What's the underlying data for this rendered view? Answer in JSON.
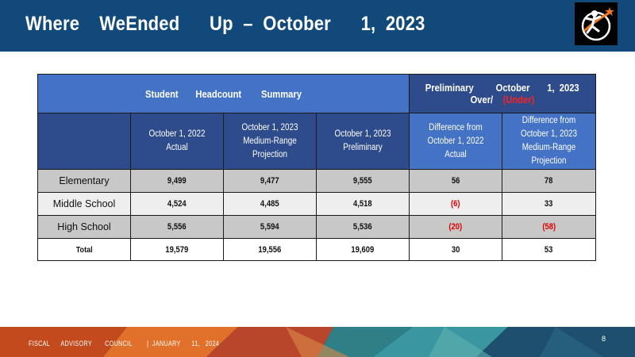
{
  "header": {
    "title": "Where    WeEnded      Up  –  October      1,  2023",
    "logo_icon": "runner-star-logo-icon",
    "background_color": "#114a7a"
  },
  "table": {
    "group_headers": {
      "summary": "Student       Headcount        Summary",
      "preliminary_line1": "Preliminary         October       1,  2023",
      "preliminary_over": "Over/",
      "preliminary_under": "(Under)"
    },
    "column_headers": [
      "",
      "October     1,  2022 Actual",
      "October     1,  2023 Medium-Range Projection",
      "October     1,  2023 Preliminary",
      "Difference       from October     1,  2022 Actual",
      "Difference       from October     1,  2023 Medium-Range Projection"
    ],
    "rows": [
      {
        "label": "Elementary",
        "values": [
          "9,499",
          "9,477",
          "9,555",
          "56",
          "78"
        ]
      },
      {
        "label": "Middle School",
        "values": [
          "4,524",
          "4,485",
          "4,518",
          "(6)",
          "33"
        ]
      },
      {
        "label": "High School",
        "values": [
          "5,556",
          "5,594",
          "5,536",
          "(20)",
          "(58)"
        ]
      },
      {
        "label": "Total",
        "values": [
          "19,579",
          "19,556",
          "19,609",
          "30",
          "53"
        ]
      }
    ]
  },
  "footer": {
    "text": "FISCAL      ADVISORY       COUNCIL        |  JANUARY      11,   2024",
    "page_number": "8"
  },
  "colors": {
    "header_blue": "#4472c4",
    "header_navy": "#2e4b8c",
    "negative_red": "#e00000"
  }
}
